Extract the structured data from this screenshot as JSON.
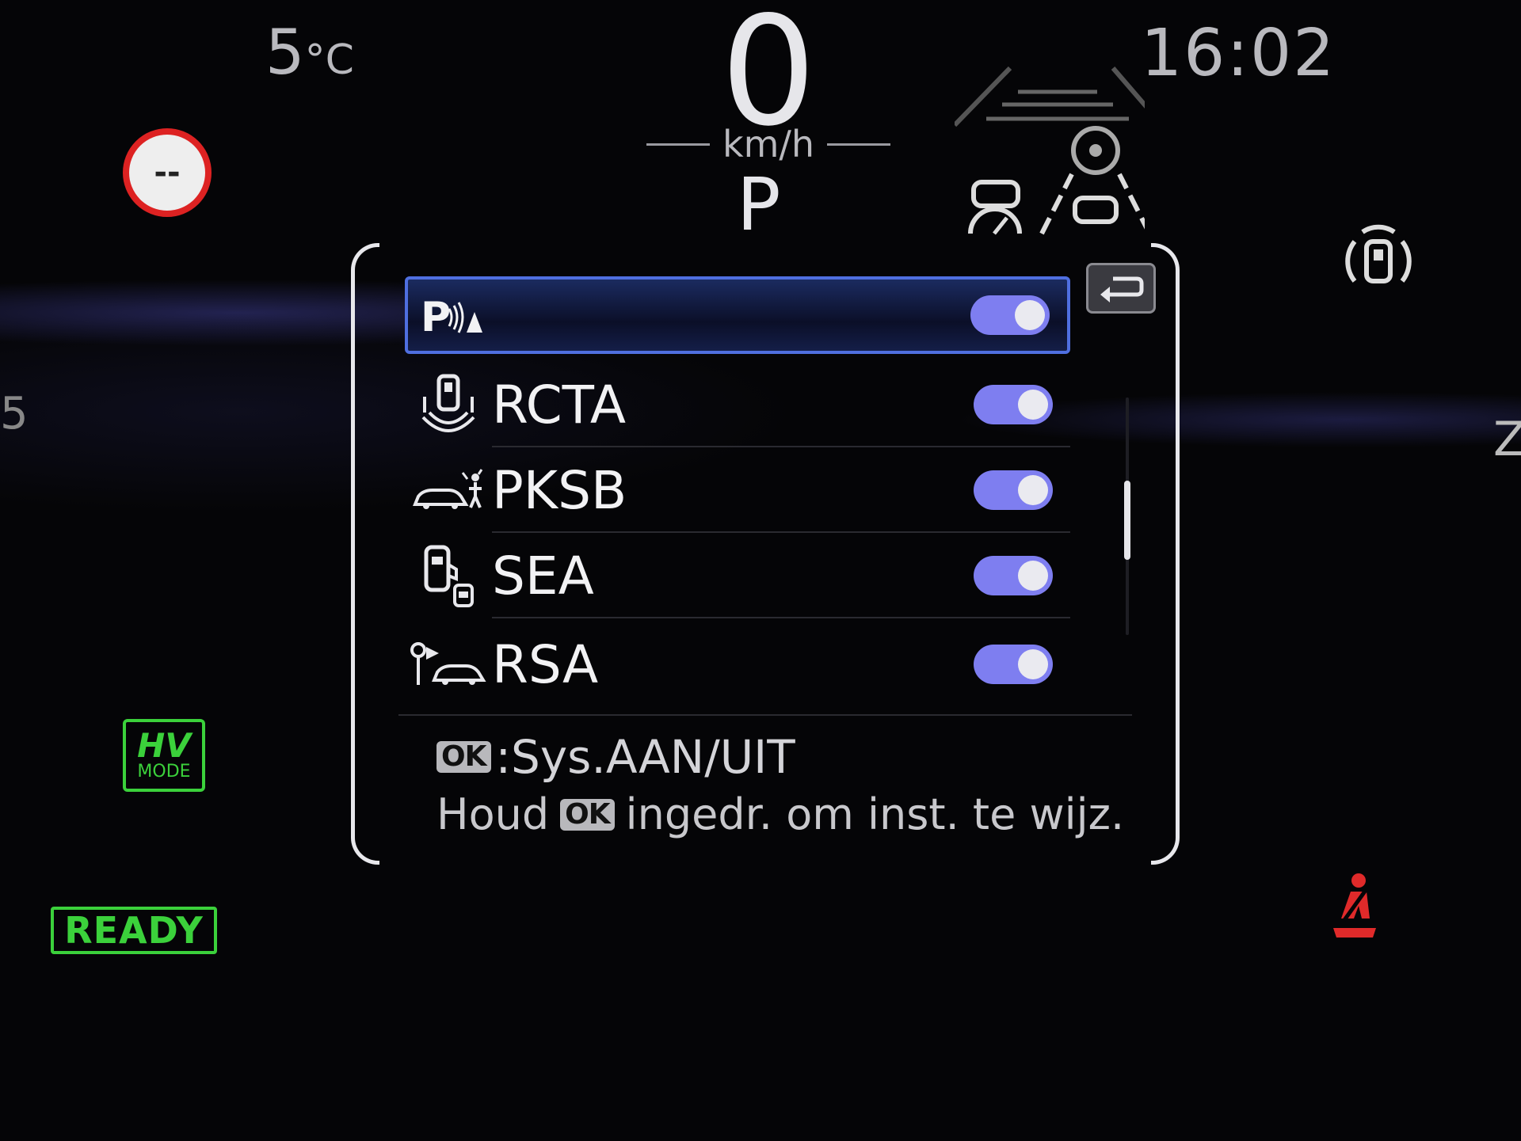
{
  "status": {
    "temperature_value": "5",
    "temperature_unit": "°C",
    "clock": "16:02",
    "speed": "0",
    "speed_unit": "km/h",
    "gear": "P",
    "speed_limit": "--",
    "left_edge": "5",
    "right_edge": "Z"
  },
  "indicators": {
    "hv_label": "HV",
    "mode_label": "MODE",
    "ready_label": "READY",
    "indicator_green": "#3bd13b",
    "seatbelt_color": "#e02a2a"
  },
  "menu": {
    "items": [
      {
        "label": "",
        "icon": "parking-sensor-icon",
        "enabled": true,
        "selected": true
      },
      {
        "label": "RCTA",
        "icon": "rear-cross-traffic-icon",
        "enabled": true,
        "selected": false
      },
      {
        "label": "PKSB",
        "icon": "parking-brake-support-icon",
        "enabled": true,
        "selected": false
      },
      {
        "label": "SEA",
        "icon": "safe-exit-assist-icon",
        "enabled": true,
        "selected": false
      },
      {
        "label": "RSA",
        "icon": "road-sign-assist-icon",
        "enabled": true,
        "selected": false
      }
    ],
    "hint_ok": "OK",
    "hint_line1": ":Sys.AAN/UIT",
    "hint_line2_pre": "Houd",
    "hint_line2_post": "ingedr. om inst. te wijz.",
    "toggle_color": "#7e7ef0",
    "selection_color": "#4f6fe0"
  }
}
